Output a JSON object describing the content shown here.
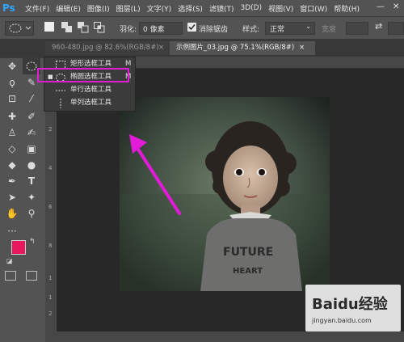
{
  "app": {
    "logo": "Ps"
  },
  "menu": {
    "items": [
      "文件(F)",
      "编辑(E)",
      "图像(I)",
      "图层(L)",
      "文字(Y)",
      "选择(S)",
      "滤镜(T)",
      "3D(D)",
      "视图(V)",
      "窗口(W)",
      "帮助(H)"
    ]
  },
  "window_controls": {
    "minimize": "—",
    "close": "✕"
  },
  "options": {
    "feather_label": "羽化:",
    "feather_value": "0 像素",
    "antialias_label": "消除锯齿",
    "style_label": "样式:",
    "style_value": "正常",
    "width_label": "宽度"
  },
  "tabs": [
    {
      "label": "960-480.jpg @ 82.6%(RGB/8#)",
      "close": "×"
    },
    {
      "label": "示例图片_03.jpg @ 75.1%(RGB/8#)",
      "close": "×"
    }
  ],
  "flyout": {
    "items": [
      {
        "label": "矩形选框工具",
        "key": "M",
        "icon": "rect-marquee-icon"
      },
      {
        "label": "椭圆选框工具",
        "key": "M",
        "icon": "ellipse-marquee-icon",
        "selected": true
      },
      {
        "label": "单行选框工具",
        "key": "",
        "icon": "single-row-icon"
      },
      {
        "label": "单列选框工具",
        "key": "",
        "icon": "single-col-icon"
      }
    ]
  },
  "ruler": {
    "marks": [
      "2",
      "4",
      "6",
      "8",
      "1",
      "1",
      "2"
    ]
  },
  "photo": {
    "shirt_text_1": "FUTURE",
    "shirt_text_2": "HEART"
  },
  "watermark": {
    "brand": "Baidu经验",
    "url": "jingyan.baidu.com"
  },
  "colors": {
    "foreground": "#e8185e",
    "background": "#ffffff",
    "annotation": "#e21bd9",
    "menubar": "#535353"
  }
}
